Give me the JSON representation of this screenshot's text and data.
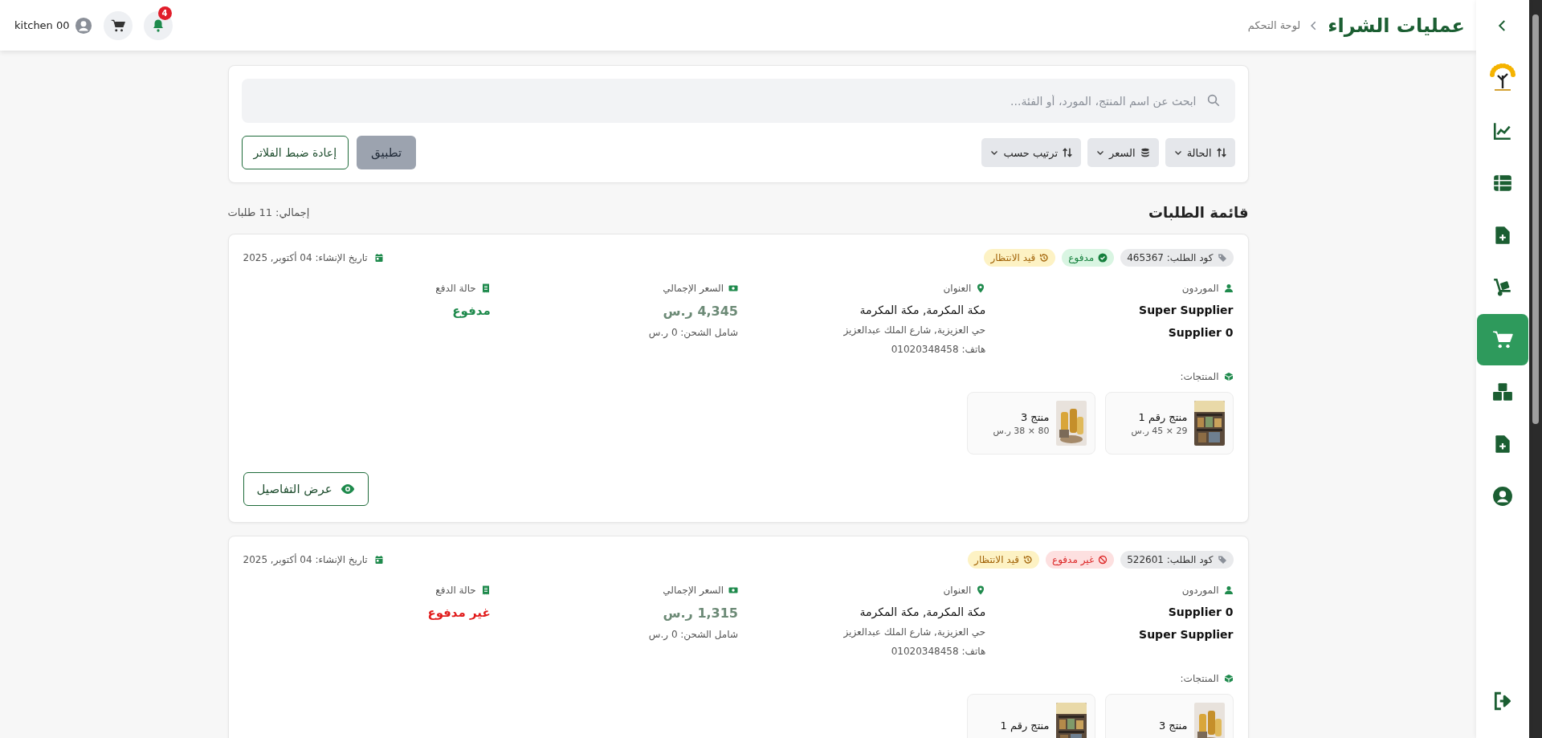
{
  "sidebar": {
    "items": [
      {
        "kind": "chart",
        "selected": false
      },
      {
        "kind": "table",
        "selected": false
      },
      {
        "kind": "file-plus",
        "selected": false
      },
      {
        "kind": "dolly",
        "selected": false
      },
      {
        "kind": "cart",
        "selected": true
      },
      {
        "kind": "boxes",
        "selected": false
      },
      {
        "kind": "file-plus",
        "selected": false
      },
      {
        "kind": "user",
        "selected": false
      }
    ],
    "footer_items": [
      {
        "kind": "logout",
        "selected": false
      }
    ]
  },
  "header": {
    "title": "عمليات الشراء",
    "breadcrumb": "لوحة التحكم",
    "notification_count": "4",
    "user": "kitchen 00"
  },
  "filters": {
    "search": {
      "placeholder": "ابحث عن اسم المنتج، المورد، أو الفئة..."
    },
    "dropdowns": [
      {
        "label": "الحالة",
        "kind": "sort"
      },
      {
        "label": "السعر",
        "kind": "coins"
      },
      {
        "label": "ترتيب حسب",
        "kind": "sort"
      }
    ],
    "apply": {
      "label": "تطبيق",
      "disabled": true
    },
    "reset": "إعادة ضبط الفلاتر"
  },
  "list": {
    "title": "قائمة الطلبات",
    "total": "إجمالي: 11 طلبات"
  },
  "orders": [
    {
      "code": "كود الطلب: 465367",
      "badges": [
        {
          "label": "مدفوع",
          "kind": "paid"
        },
        {
          "label": "قيد الانتظار",
          "kind": "pending"
        }
      ],
      "date": "تاريخ الإنشاء: 04 أكتوبر, 2025",
      "suppliers_label": "الموردون",
      "suppliers": [
        "Super Supplier",
        "Supplier 0"
      ],
      "address_label": "العنوان",
      "address_city": "مكة المكرمة, مكة المكرمة",
      "address_street": "حي العزيزية, شارع الملك عبدالعزيز",
      "phone": "هاتف: 01020348458",
      "total_label": "السعر الإجمالي",
      "total": "4,345 ر.س",
      "shipping": "شامل الشحن: 0 ر.س",
      "payment_label": "حالة الدفع",
      "payment_status": {
        "label": "مدفوع",
        "kind": "paid"
      },
      "products_label": "المنتجات:",
      "products": [
        {
          "name": "منتج رقم 1",
          "detail": "29 × 45 ر.س"
        },
        {
          "name": "منتج 3",
          "detail": "80 × 38 ر.س"
        }
      ],
      "details_button": "عرض التفاصيل"
    },
    {
      "code": "كود الطلب: 522601",
      "badges": [
        {
          "label": "غير مدفوع",
          "kind": "unpaid"
        },
        {
          "label": "قيد الانتظار",
          "kind": "pending"
        }
      ],
      "date": "تاريخ الإنشاء: 04 أكتوبر, 2025",
      "suppliers_label": "الموردون",
      "suppliers": [
        "Supplier 0",
        "Super Supplier"
      ],
      "address_label": "العنوان",
      "address_city": "مكة المكرمة, مكة المكرمة",
      "address_street": "حي العزيزية, شارع الملك عبدالعزيز",
      "phone": "هاتف: 01020348458",
      "total_label": "السعر الإجمالي",
      "total": "1,315 ر.س",
      "shipping": "شامل الشحن: 0 ر.س",
      "payment_label": "حالة الدفع",
      "payment_status": {
        "label": "غير مدفوع",
        "kind": "unpaid"
      },
      "products_label": "المنتجات:",
      "products": [
        {
          "name": "منتج 3"
        },
        {
          "name": "منتج رقم 1"
        }
      ]
    }
  ]
}
